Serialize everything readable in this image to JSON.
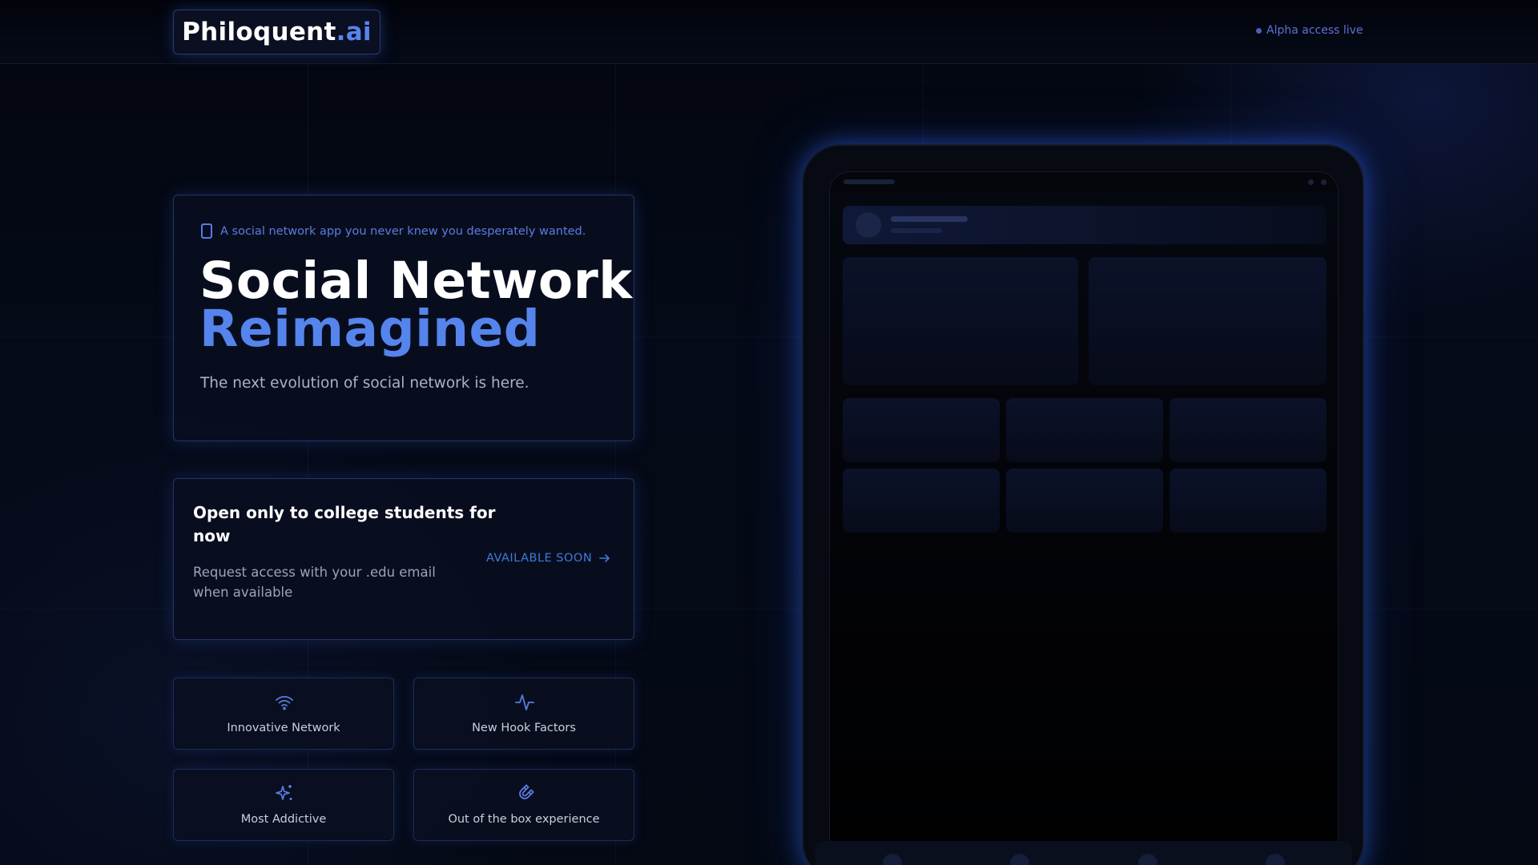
{
  "header": {
    "logo_name": "Philoquent",
    "logo_tld": ".ai",
    "status_text": "Alpha access live"
  },
  "hero": {
    "tagline": "A social network app you never knew you desperately wanted.",
    "title_line1": "Social Network",
    "title_line2": "Reimagined",
    "subtitle": "The next evolution of social network is here."
  },
  "access": {
    "heading": "Open only to college students for now",
    "description": "Request access with your .edu email when available",
    "cta_label": "AVAILABLE SOON"
  },
  "features": [
    {
      "label": "Innovative Network",
      "icon": "wifi-icon"
    },
    {
      "label": "New Hook Factors",
      "icon": "activity-icon"
    },
    {
      "label": "Most Addictive",
      "icon": "sparkles-icon"
    },
    {
      "label": "Out of the box experience",
      "icon": "magnet-icon"
    }
  ],
  "colors": {
    "background": "#050a18",
    "accent": "#5584ec",
    "link": "#3f7ad6",
    "card_border": "#3a5aa8"
  }
}
